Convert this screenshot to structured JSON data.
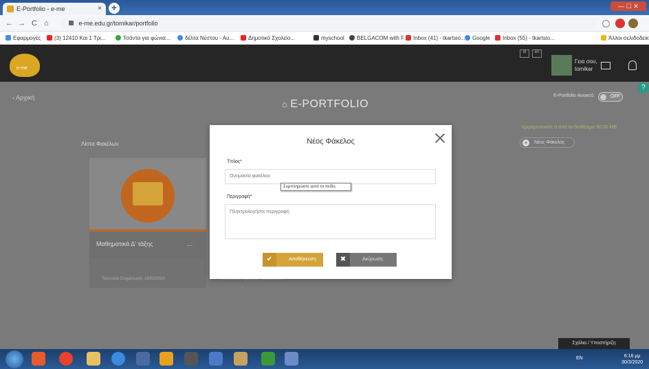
{
  "browser": {
    "tab_title": "E-Portfolio - e-me",
    "tab_close": "×",
    "new_tab": "+",
    "url": "e-me.edu.gr/tomikar/portfolio",
    "nav_back": "←",
    "nav_forward": "→",
    "nav_reload": "C",
    "nav_home": "⌂",
    "bookmarks": [
      "Εφαρμογές",
      "(3) 12410 Και 1 Τρι...",
      "Τσάντα για φώνια...",
      "δέλτα Νέστου - Αυ...",
      "Δημοτικό Σχολείο...",
      "myschool",
      "BELGACOM with F...",
      "Inbox (41) - tkartsio...",
      "Google",
      "Inbox (55) - tkartsio..."
    ],
    "other_bookmarks": "Άλλοι σελιδοδείκτες"
  },
  "header": {
    "logo_text": "e-me",
    "greeting_line1": "Γεια σου,",
    "greeting_line2": "tomikar",
    "lang_1": "el",
    "lang_2": "en"
  },
  "page": {
    "back_label": "Αρχική",
    "title": "E-PORTFOLIO",
    "open_label": "E-Portfolio Ανοικτό:",
    "toggle_state": "OFF",
    "usage_text": "Χρησιμοποιείτε 0 από τα διαθέσιμα 50.00 MB",
    "new_folder_label": "Νέος Φάκελος",
    "list_title": "Λίστα Φακέλων",
    "card_name": "Μαθηματικά Δ' τάξης",
    "card_menu": "...",
    "last_modified": "Τελευταία Ενημέρωση: 19/03/2020",
    "last_modified_2": "Τελευταία Ενημέρωση: 19/03/2020",
    "support_label": "Σχόλια / Υποστήριξη"
  },
  "modal": {
    "title": "Νέος Φάκελος",
    "title_label": "Τίτλος*",
    "title_placeholder": "Ονομασία φακέλου",
    "tooltip": "Συμπληρώστε αυτό το πεδίο.",
    "desc_label": "Περιγραφή*",
    "desc_placeholder": "Πληκτρολογήστε περιγραφή",
    "save_label": "Αποθήκευση",
    "cancel_label": "Ακύρωση"
  },
  "taskbar": {
    "tray_lang": "EN",
    "clock_time": "6:16 μμ",
    "clock_date": "30/3/2020"
  },
  "colors": {
    "accent": "#d4a43a",
    "folder_orange": "#c0661e",
    "header_dark": "#262626"
  }
}
